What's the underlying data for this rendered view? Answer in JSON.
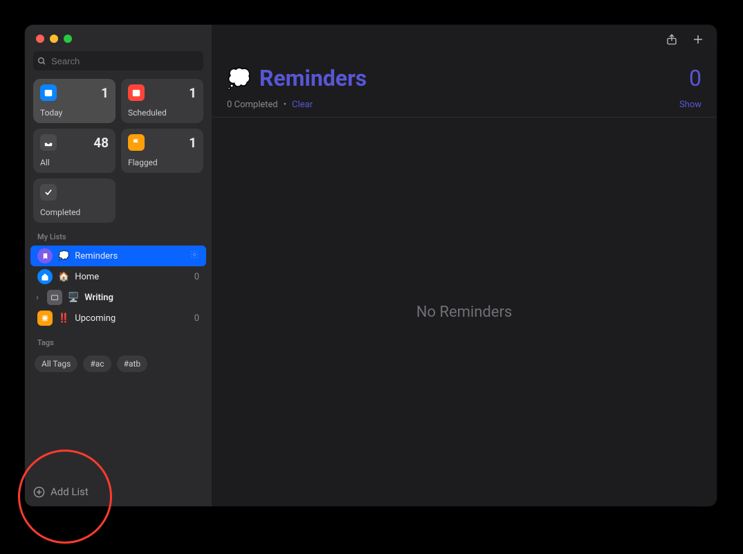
{
  "search": {
    "placeholder": "Search"
  },
  "smart": {
    "today": {
      "label": "Today",
      "count": "1"
    },
    "scheduled": {
      "label": "Scheduled",
      "count": "1"
    },
    "all": {
      "label": "All",
      "count": "48"
    },
    "flagged": {
      "label": "Flagged",
      "count": "1"
    },
    "completed": {
      "label": "Completed",
      "count": ""
    }
  },
  "sections": {
    "mylists": "My Lists",
    "tags": "Tags"
  },
  "lists": [
    {
      "name": "Reminders",
      "emoji": "💭",
      "count": ""
    },
    {
      "name": "Home",
      "emoji": "🏠",
      "count": "0"
    },
    {
      "name": "Writing",
      "emoji": "🖥️",
      "count": ""
    },
    {
      "name": "Upcoming",
      "emoji": "‼️",
      "count": "0"
    }
  ],
  "tags": {
    "all": "All Tags",
    "t1": "#ac",
    "t2": "#atb"
  },
  "addList": "Add List",
  "main": {
    "title": "Reminders",
    "count": "0",
    "completed": "0 Completed",
    "dot": "•",
    "clear": "Clear",
    "show": "Show",
    "empty": "No Reminders"
  }
}
